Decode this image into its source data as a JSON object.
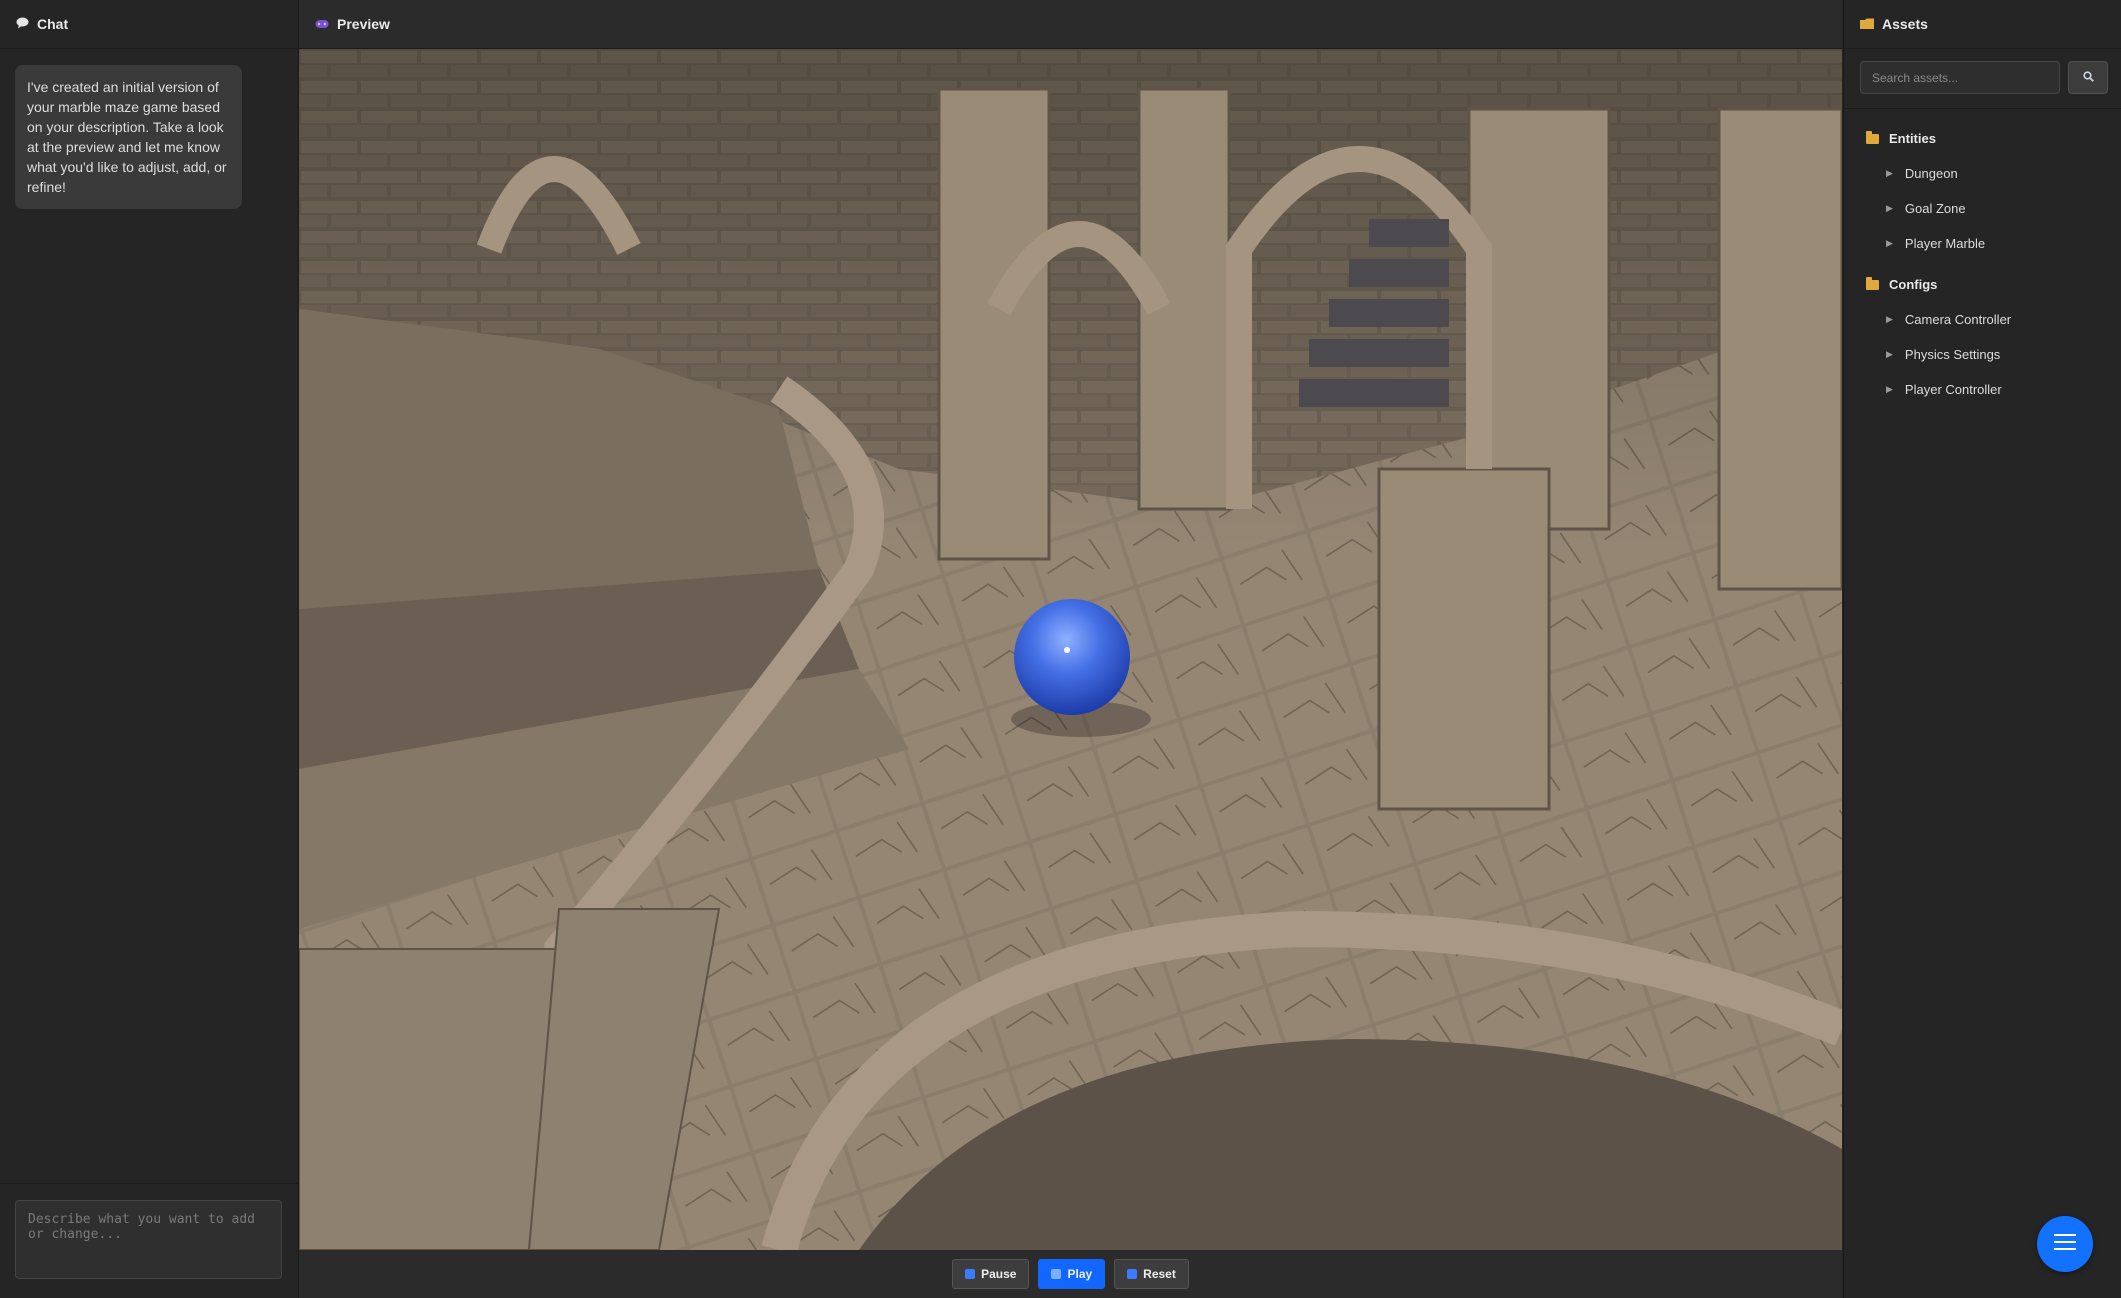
{
  "chat": {
    "title": "Chat",
    "message": "I've created an initial version of your marble maze game based on your description. Take a look at the preview and let me know what you'd like to adjust, add, or refine!",
    "input_placeholder": "Describe what you want to add or change..."
  },
  "preview": {
    "title": "Preview",
    "scene": "dungeon marble maze with a blue marble on stone tiles",
    "controls": {
      "pause": "Pause",
      "play": "Play",
      "reset": "Reset"
    }
  },
  "assets": {
    "title": "Assets",
    "search_placeholder": "Search assets...",
    "groups": [
      {
        "name": "Entities",
        "items": [
          "Dungeon",
          "Goal Zone",
          "Player Marble"
        ]
      },
      {
        "name": "Configs",
        "items": [
          "Camera Controller",
          "Physics Settings",
          "Player Controller"
        ]
      }
    ]
  },
  "colors": {
    "accent": "#1167ff",
    "folder": "#e0a93c",
    "marble": "#3f66e0"
  },
  "icons": {
    "chat": "speech-bubble-icon",
    "preview": "gamepad-icon",
    "assets": "folder-icon",
    "search": "magnifier-icon",
    "fab": "menu-icon"
  }
}
